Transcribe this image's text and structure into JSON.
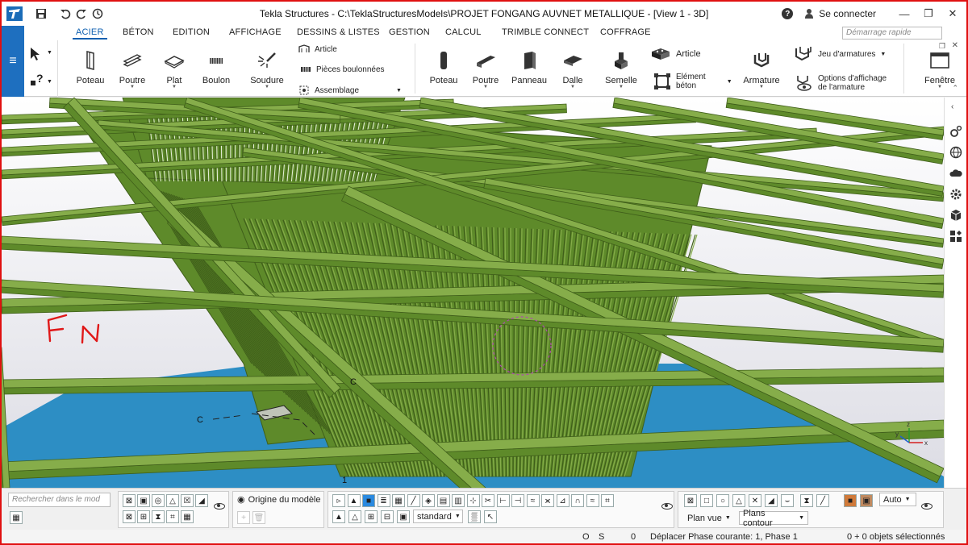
{
  "window": {
    "title": "Tekla Structures - C:\\TeklaStructuresModels\\PROJET FONGANG AUVNET METALLIQUE  - [View 1 - 3D]",
    "user_label": "Se connecter"
  },
  "tabs": [
    "ACIER",
    "BÉTON",
    "EDITION",
    "AFFICHAGE",
    "DESSINS & LISTES",
    "GESTION",
    "CALCUL",
    "TRIMBLE CONNECT",
    "COFFRAGE"
  ],
  "active_tab": "ACIER",
  "quick_search_placeholder": "Démarrage rapide",
  "ribbon": {
    "steel": {
      "poteau": "Poteau",
      "poutre": "Poutre",
      "plat": "Plat",
      "boulon": "Boulon",
      "soudure": "Soudure",
      "article": "Article",
      "pieces_boulonnees": "Pièces boulonnées",
      "assemblage": "Assemblage"
    },
    "concrete": {
      "poteau": "Poteau",
      "poutre": "Poutre",
      "panneau": "Panneau",
      "dalle": "Dalle",
      "semelle": "Semelle",
      "article": "Article",
      "element_beton_1": "Elément",
      "element_beton_2": "béton",
      "armature": "Armature",
      "jeu_armatures": "Jeu d'armatures",
      "options_affichage_1": "Options d'affichage",
      "options_affichage_2": "de l'armature"
    },
    "fenetre": "Fenêtre"
  },
  "viewport": {
    "annotation": "F N",
    "grid_label_c1": "C",
    "grid_label_c2": "C",
    "grid_label_1": "1",
    "axis_z": "z",
    "axis_y": "y",
    "axis_x": "x",
    "colors": {
      "steel": "#5e8a2a",
      "steel_light": "#86ad4a",
      "steel_dark": "#3f5e1a",
      "ground": "#2d8ec4",
      "sky": "#ececf0",
      "annotation": "#e01818"
    }
  },
  "bottom_toolbar": {
    "search_placeholder": "Rechercher dans le mod",
    "origin_label": "Origine du modèle",
    "standard_combo": "standard",
    "auto_combo": "Auto",
    "plan_vue": "Plan vue",
    "plans_contour": "Plans contour"
  },
  "status_bar": {
    "o": "O",
    "s": "S",
    "zero": "0",
    "message": "Déplacer Phase courante: 1, Phase 1",
    "selection": "0 + 0 objets sélectionnés"
  }
}
